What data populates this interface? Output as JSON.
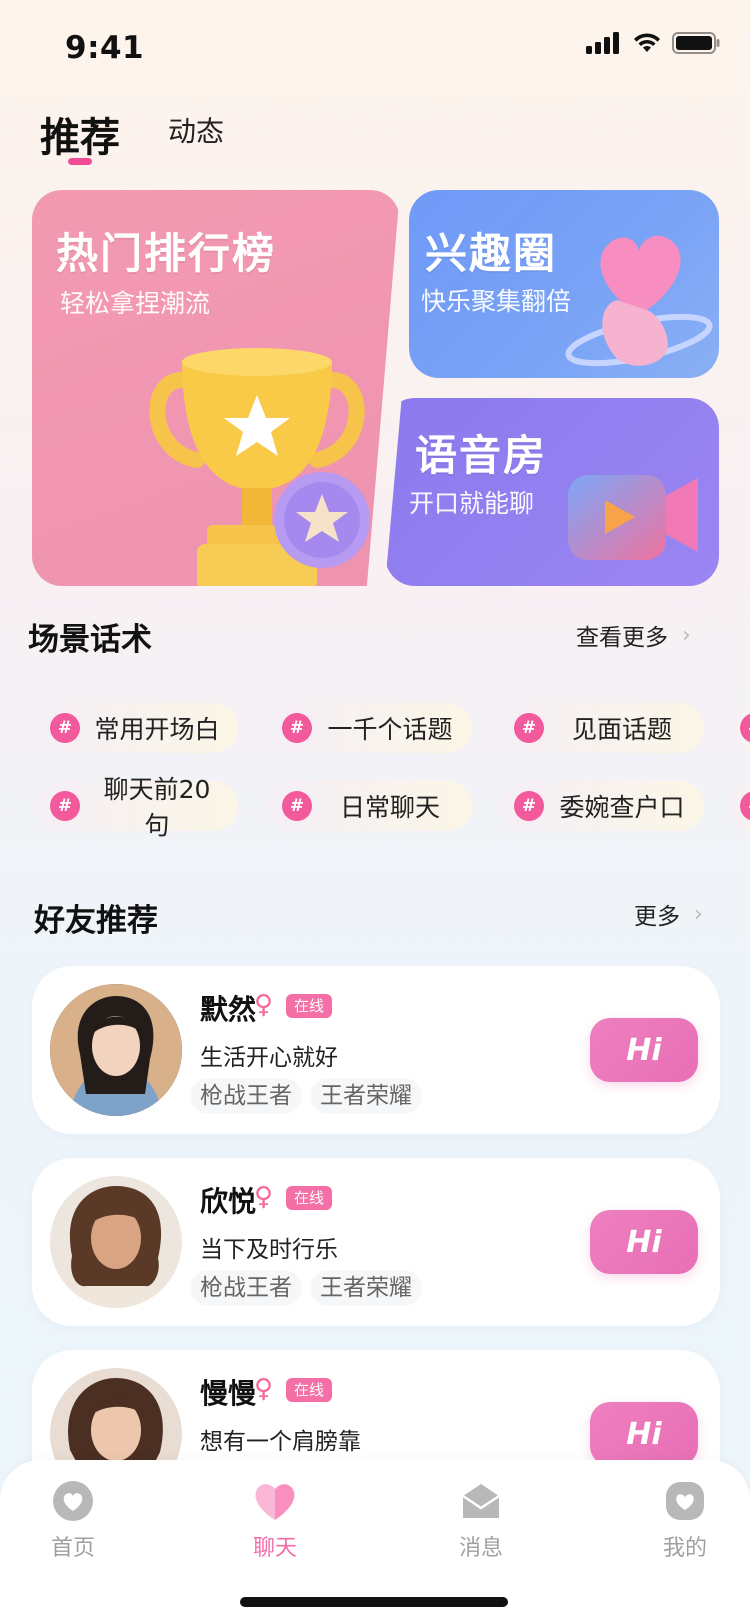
{
  "status": {
    "time": "9:41"
  },
  "tabs": {
    "active": "推荐",
    "other": "动态"
  },
  "cards": {
    "ranking": {
      "title": "热门排行榜",
      "subtitle": "轻松拿捏潮流"
    },
    "circle": {
      "title": "兴趣圈",
      "subtitle": "快乐聚集翻倍"
    },
    "voice": {
      "title": "语音房",
      "subtitle": "开口就能聊"
    }
  },
  "scripts_section": {
    "title": "场景话术",
    "more": "查看更多",
    "chip_icon": "#",
    "chips": [
      "常用开场白",
      "一千个话题",
      "见面话题",
      "聊天前20句",
      "日常聊天",
      "委婉查户口"
    ]
  },
  "friends_section": {
    "title": "好友推荐",
    "more": "更多",
    "online_label": "在线",
    "gender_symbol": "♀",
    "hi_label": "Hi",
    "friends": [
      {
        "name": "默然",
        "bio": "生活开心就好",
        "tags": [
          "枪战王者",
          "王者荣耀"
        ]
      },
      {
        "name": "欣悦",
        "bio": "当下及时行乐",
        "tags": [
          "枪战王者",
          "王者荣耀"
        ]
      },
      {
        "name": "慢慢",
        "bio": "想有一个肩膀靠",
        "tags": []
      }
    ]
  },
  "nav": {
    "items": [
      {
        "label": "首页",
        "icon": "home-heart-icon"
      },
      {
        "label": "聊天",
        "icon": "chat-heart-icon"
      },
      {
        "label": "消息",
        "icon": "envelope-icon"
      },
      {
        "label": "我的",
        "icon": "profile-heart-icon"
      }
    ],
    "active_index": 1
  },
  "colors": {
    "accent": "#f24b95",
    "hi_button": "#e86fb5",
    "ranking_card": "#ef95b0",
    "circle_card": "#739df6",
    "voice_card": "#917ff0"
  }
}
